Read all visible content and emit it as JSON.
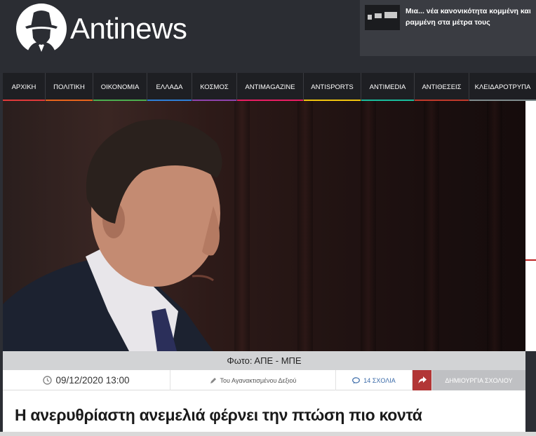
{
  "site": {
    "name": "Antinews"
  },
  "promo": {
    "text": "Μια... νέα κανονικότητα κομμένη και ραμμένη στα μέτρα τους"
  },
  "nav": {
    "items": [
      {
        "label": "ΑΡΧΙΚΗ",
        "color": "#e03a3a"
      },
      {
        "label": "ΠΟΛΙΤΙΚΗ",
        "color": "#e9651c"
      },
      {
        "label": "ΟΙΚΟΝΟΜΙΑ",
        "color": "#4caf50"
      },
      {
        "label": "ΕΛΛΑΔΑ",
        "color": "#2f7fd6"
      },
      {
        "label": "ΚΟΣΜΟΣ",
        "color": "#8e44ad"
      },
      {
        "label": "ANTIMAGAZINE",
        "color": "#e91e63"
      },
      {
        "label": "ANTISPORTS",
        "color": "#f1c40f"
      },
      {
        "label": "ANTIMEDIA",
        "color": "#1abc9c"
      },
      {
        "label": "ΑΝΤΙΘΕΣΕΙΣ",
        "color": "#c0392b"
      },
      {
        "label": "ΚΛΕΙΔΑΡΟΤΡΥΠΑ",
        "color": "#7f8c8d"
      }
    ]
  },
  "article": {
    "photo_caption": "Φωτο: ΑΠΕ - ΜΠΕ",
    "date": "09/12/2020 13:00",
    "author": "Του Αγανακτισμένου Δεξιού",
    "comments": "14 ΣΧΟΛΙΑ",
    "create_comment": "ΔΗΜΙΟΥΡΓΙΑ ΣΧΟΛΙΟΥ",
    "title": "Η ανερυθρίαστη ανεμελιά φέρνει την πτώση πιο κοντά"
  },
  "colors": {
    "accent": "#b23636",
    "header_bg": "#2b2d33",
    "nav_bg": "#1e1f23"
  }
}
